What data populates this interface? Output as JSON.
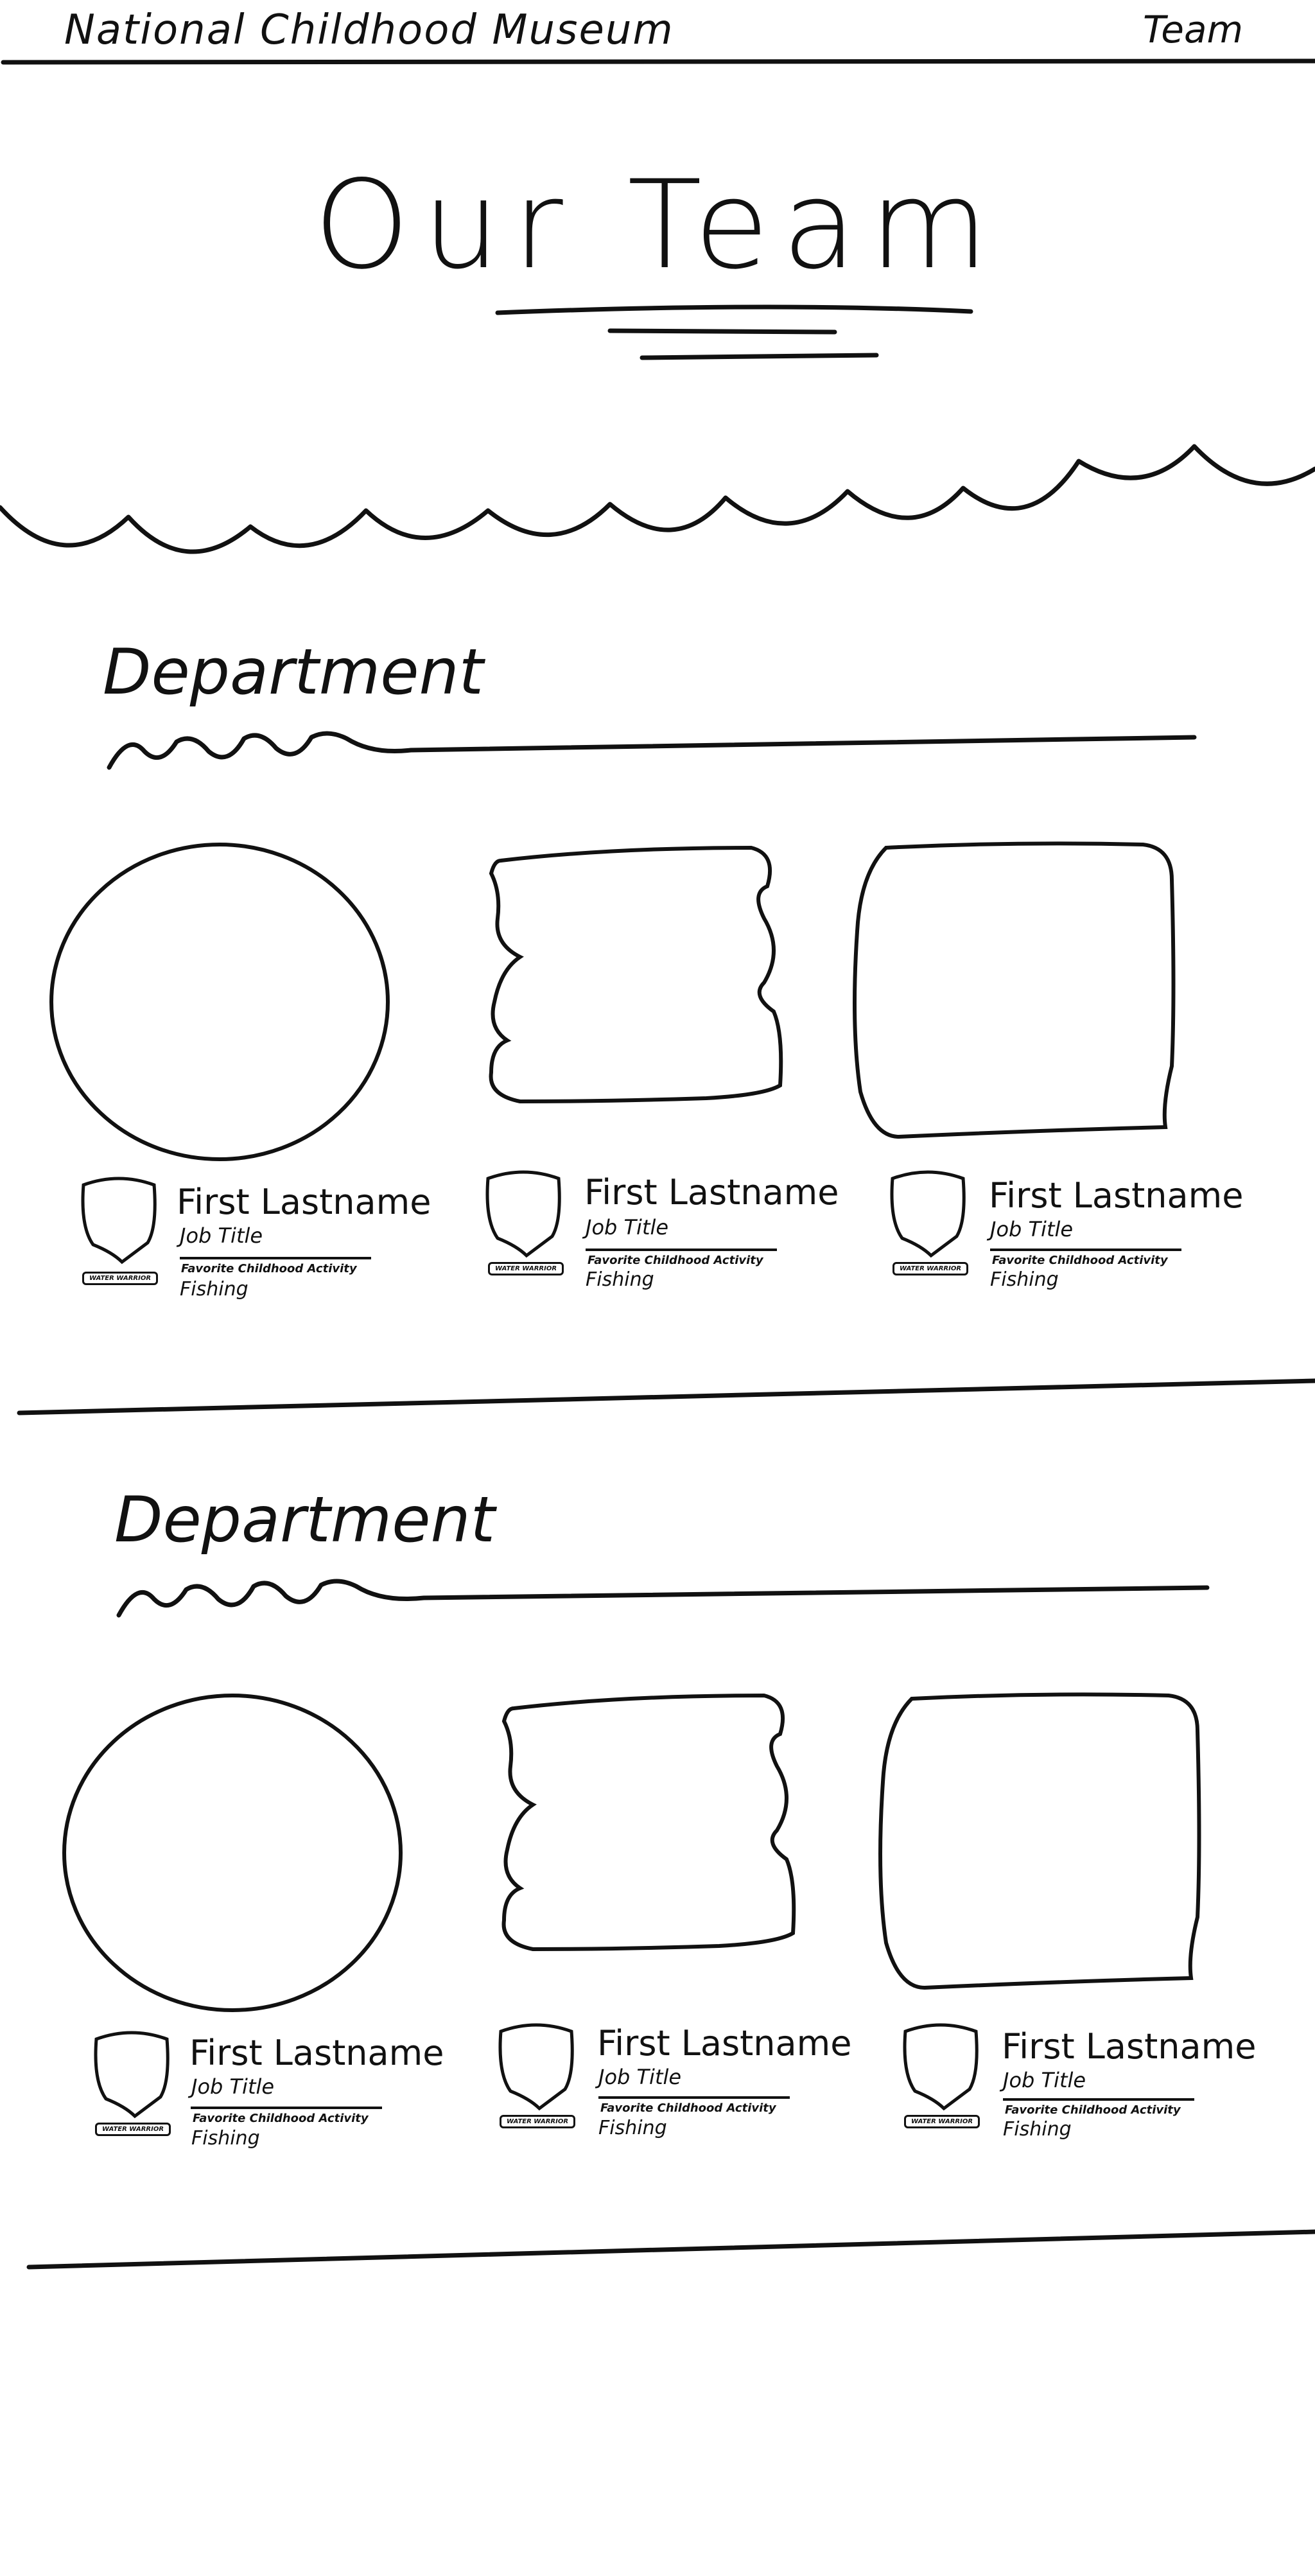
{
  "header": {
    "site_title": "National Childhood Museum",
    "menu_label": "Team"
  },
  "page": {
    "title": "Our Team"
  },
  "departments": [
    {
      "title": "Department",
      "members": [
        {
          "name": "First Lastname",
          "job_title": "Job Title",
          "fav_label": "Favorite Childhood Activity",
          "fav_value": "Fishing",
          "badge": "WATER WARRIOR",
          "photo_shape": "circle"
        },
        {
          "name": "First Lastname",
          "job_title": "Job Title",
          "fav_label": "Favorite Childhood Activity",
          "fav_value": "Fishing",
          "badge": "WATER WARRIOR",
          "photo_shape": "wavy-square"
        },
        {
          "name": "First Lastname",
          "job_title": "Job Title",
          "fav_label": "Favorite Childhood Activity",
          "fav_value": "Fishing",
          "badge": "WATER WARRIOR",
          "photo_shape": "rounded-square"
        }
      ]
    },
    {
      "title": "Department",
      "members": [
        {
          "name": "First Lastname",
          "job_title": "Job Title",
          "fav_label": "Favorite Childhood Activity",
          "fav_value": "Fishing",
          "badge": "WATER WARRIOR",
          "photo_shape": "circle"
        },
        {
          "name": "First Lastname",
          "job_title": "Job Title",
          "fav_label": "Favorite Childhood Activity",
          "fav_value": "Fishing",
          "badge": "WATER WARRIOR",
          "photo_shape": "wavy-square"
        },
        {
          "name": "First Lastname",
          "job_title": "Job Title",
          "fav_label": "Favorite Childhood Activity",
          "fav_value": "Fishing",
          "badge": "WATER WARRIOR",
          "photo_shape": "rounded-square"
        }
      ]
    }
  ],
  "colors": {
    "ink": "#111111",
    "background": "#ffffff"
  }
}
